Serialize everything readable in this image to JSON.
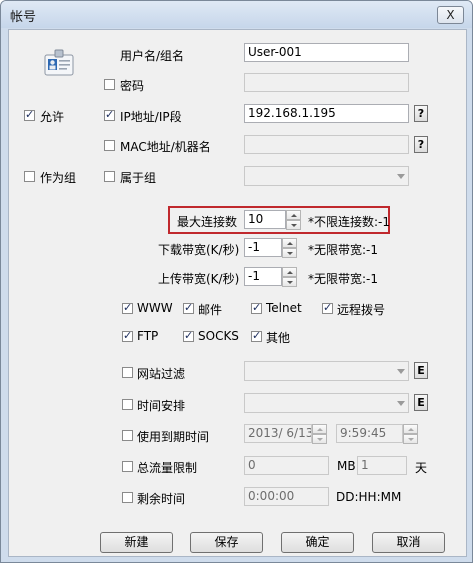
{
  "window": {
    "title": "帐号",
    "close_glyph": "X"
  },
  "account": {
    "username_label": "用户名/组名",
    "username_value": "User-001",
    "password_label": "密码",
    "password_checked": false,
    "allow_label": "允许",
    "allow_checked": true,
    "ip_label": "IP地址/IP段",
    "ip_checked": true,
    "ip_value": "192.168.1.195",
    "ip_help": "?",
    "mac_label": "MAC地址/机器名",
    "mac_checked": false,
    "mac_help": "?",
    "as_group_label": "作为组",
    "as_group_checked": false,
    "belongs_label": "属于组",
    "belongs_checked": false
  },
  "limits": {
    "max_conn_label": "最大连接数",
    "max_conn_value": "10",
    "max_conn_hint": "*不限连接数:-1",
    "download_label": "下载带宽(K/秒)",
    "download_value": "-1",
    "download_hint": "*无限带宽:-1",
    "upload_label": "上传带宽(K/秒)",
    "upload_value": "-1",
    "upload_hint": "*无限带宽:-1"
  },
  "services": [
    {
      "label": "WWW",
      "checked": true
    },
    {
      "label": "邮件",
      "checked": true
    },
    {
      "label": "Telnet",
      "checked": true
    },
    {
      "label": "远程拨号",
      "checked": true
    },
    {
      "label": "FTP",
      "checked": true
    },
    {
      "label": "SOCKS",
      "checked": true
    },
    {
      "label": "其他",
      "checked": true
    }
  ],
  "options": {
    "web_filter_label": "网站过滤",
    "web_filter_edit": "E",
    "schedule_label": "时间安排",
    "schedule_edit": "E",
    "expiry_label": "使用到期时间",
    "expiry_date": "2013/ 6/13",
    "expiry_time": "9:59:45",
    "quota_label": "总流量限制",
    "quota_value": "0",
    "quota_unit1": "MB",
    "quota_value2": "1",
    "quota_unit2": "天",
    "remaining_label": "剩余时间",
    "remaining_value": "0:00:00",
    "remaining_format": "DD:HH:MM"
  },
  "buttons": {
    "new": "新建",
    "save": "保存",
    "ok": "确定",
    "cancel": "取消"
  }
}
